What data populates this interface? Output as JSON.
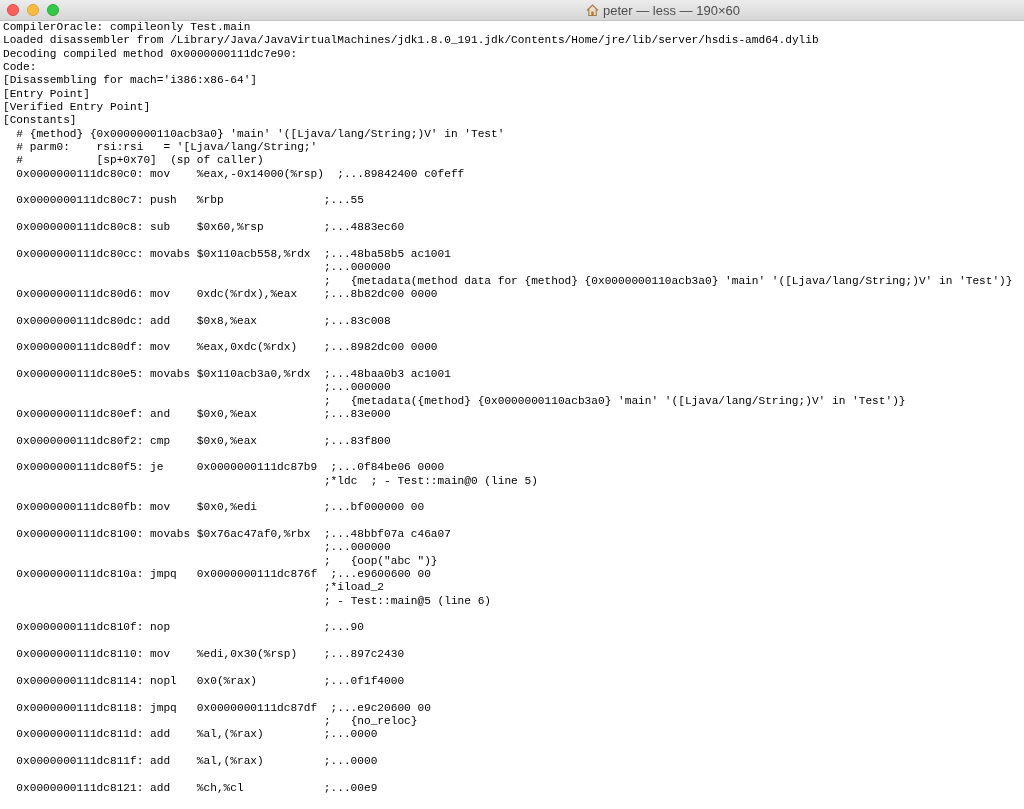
{
  "window": {
    "title": "peter — less — 190×60"
  },
  "preamble": [
    "CompilerOracle: compileonly Test.main",
    "Loaded disassembler from /Library/Java/JavaVirtualMachines/jdk1.8.0_191.jdk/Contents/Home/jre/lib/server/hsdis-amd64.dylib",
    "Decoding compiled method 0x0000000111dc7e90:",
    "Code:",
    "[Disassembling for mach='i386:x86-64']",
    "[Entry Point]",
    "[Verified Entry Point]",
    "[Constants]"
  ],
  "constant_comments": [
    "# {method} {0x0000000110acb3a0} 'main' '([Ljava/lang/String;)V' in 'Test'",
    "# parm0:    rsi:rsi   = '[Ljava/lang/String;'",
    "#           [sp+0x70]  (sp of caller)"
  ],
  "blocks": [
    [
      {
        "address": "0x0000000111dc80c0:",
        "mnemonic": "mov",
        "operands": "%eax,-0x14000(%rsp)",
        "comments": [
          ";...89842400 c0feff"
        ]
      }
    ],
    [
      {
        "address": "0x0000000111dc80c7:",
        "mnemonic": "push",
        "operands": "%rbp",
        "comments": [
          ";...55"
        ]
      }
    ],
    [
      {
        "address": "0x0000000111dc80c8:",
        "mnemonic": "sub",
        "operands": "$0x60,%rsp",
        "comments": [
          ";...4883ec60"
        ]
      }
    ],
    [
      {
        "address": "0x0000000111dc80cc:",
        "mnemonic": "movabs",
        "operands": "$0x110acb558,%rdx",
        "comments": [
          ";...48ba58b5 ac1001",
          ";...000000",
          ";   {metadata(method data for {method} {0x0000000110acb3a0} 'main' '([Ljava/lang/String;)V' in 'Test')}"
        ]
      },
      {
        "address": "0x0000000111dc80d6:",
        "mnemonic": "mov",
        "operands": "0xdc(%rdx),%eax",
        "comments": [
          ";...8b82dc00 0000"
        ]
      }
    ],
    [
      {
        "address": "0x0000000111dc80dc:",
        "mnemonic": "add",
        "operands": "$0x8,%eax",
        "comments": [
          ";...83c008"
        ]
      }
    ],
    [
      {
        "address": "0x0000000111dc80df:",
        "mnemonic": "mov",
        "operands": "%eax,0xdc(%rdx)",
        "comments": [
          ";...8982dc00 0000"
        ]
      }
    ],
    [
      {
        "address": "0x0000000111dc80e5:",
        "mnemonic": "movabs",
        "operands": "$0x110acb3a0,%rdx",
        "comments": [
          ";...48baa0b3 ac1001",
          ";...000000",
          ";   {metadata({method} {0x0000000110acb3a0} 'main' '([Ljava/lang/String;)V' in 'Test')}"
        ]
      },
      {
        "address": "0x0000000111dc80ef:",
        "mnemonic": "and",
        "operands": "$0x0,%eax",
        "comments": [
          ";...83e000"
        ]
      }
    ],
    [
      {
        "address": "0x0000000111dc80f2:",
        "mnemonic": "cmp",
        "operands": "$0x0,%eax",
        "comments": [
          ";...83f800"
        ]
      }
    ],
    [
      {
        "address": "0x0000000111dc80f5:",
        "mnemonic": "je",
        "operands": "0x0000000111dc87b9",
        "comments": [
          ";...0f84be06 0000",
          ";*ldc  ; - Test::main@0 (line 5)"
        ]
      }
    ],
    [
      {
        "address": "0x0000000111dc80fb:",
        "mnemonic": "mov",
        "operands": "$0x0,%edi",
        "comments": [
          ";...bf000000 00"
        ]
      }
    ],
    [
      {
        "address": "0x0000000111dc8100:",
        "mnemonic": "movabs",
        "operands": "$0x76ac47af0,%rbx",
        "comments": [
          ";...48bbf07a c46a07",
          ";...000000",
          ";   {oop(\"abc \")}"
        ]
      },
      {
        "address": "0x0000000111dc810a:",
        "mnemonic": "jmpq",
        "operands": "0x0000000111dc876f",
        "comments": [
          ";...e9600600 00",
          ";*iload_2",
          "; - Test::main@5 (line 6)"
        ]
      }
    ],
    [
      {
        "address": "0x0000000111dc810f:",
        "mnemonic": "nop",
        "comments": [
          ";...90"
        ]
      }
    ],
    [
      {
        "address": "0x0000000111dc8110:",
        "mnemonic": "mov",
        "operands": "%edi,0x30(%rsp)",
        "comments": [
          ";...897c2430"
        ]
      }
    ],
    [
      {
        "address": "0x0000000111dc8114:",
        "mnemonic": "nopl",
        "operands": "0x0(%rax)",
        "comments": [
          ";...0f1f4000"
        ]
      }
    ],
    [
      {
        "address": "0x0000000111dc8118:",
        "mnemonic": "jmpq",
        "operands": "0x0000000111dc87df",
        "comments": [
          ";...e9c20600 00",
          ";   {no_reloc}"
        ]
      },
      {
        "address": "0x0000000111dc811d:",
        "mnemonic": "add",
        "operands": "%al,(%rax)",
        "comments": [
          ";...0000"
        ]
      }
    ],
    [
      {
        "address": "0x0000000111dc811f:",
        "mnemonic": "add",
        "operands": "%al,(%rax)",
        "comments": [
          ";...0000"
        ]
      }
    ],
    [
      {
        "address": "0x0000000111dc8121:",
        "mnemonic": "add",
        "operands": "%ch,%cl",
        "comments": [
          ";...00e9"
        ]
      }
    ]
  ]
}
